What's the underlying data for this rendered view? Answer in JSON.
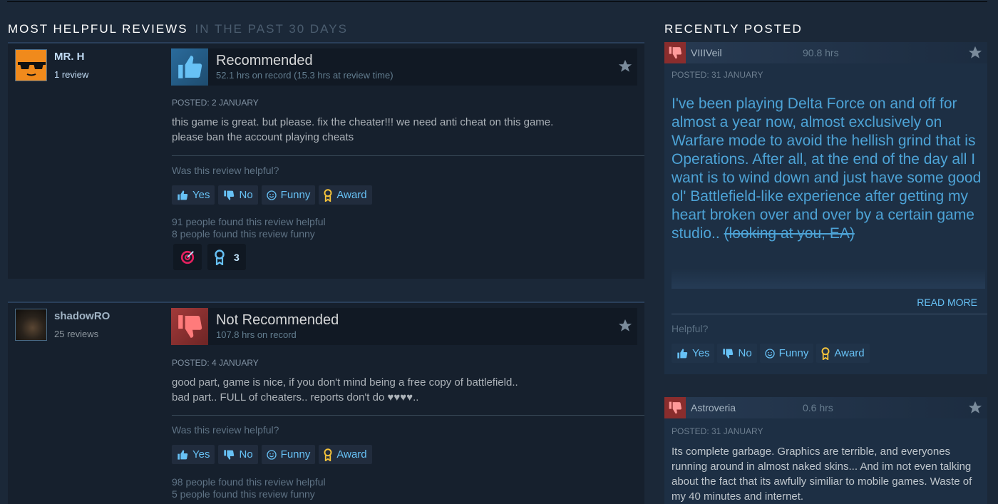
{
  "headings": {
    "most_helpful": "MOST HELPFUL REVIEWS",
    "period": "IN THE PAST 30 DAYS",
    "recently_posted": "RECENTLY POSTED"
  },
  "reviews": [
    {
      "author": "MR. H",
      "review_count": "1 review",
      "verdict": "Recommended",
      "hours": "52.1 hrs on record (15.3 hrs at review time)",
      "posted": "POSTED: 2 JANUARY",
      "lines": [
        "this game is great. but please. fix the cheater!!! we need anti cheat on this game.",
        "please ban the account playing cheats"
      ],
      "helpful_question": "Was this review helpful?",
      "buttons": {
        "yes": "Yes",
        "no": "No",
        "funny": "Funny",
        "award": "Award"
      },
      "helpful_count": "91 people found this review helpful",
      "funny_count": "8 people found this review funny",
      "award_count": "3"
    },
    {
      "author": "shadowRO",
      "review_count": "25 reviews",
      "verdict": "Not Recommended",
      "hours": "107.8 hrs on record",
      "posted": "POSTED: 4 JANUARY",
      "lines": [
        "good part, game is nice, if you don't mind being a free copy of battlefield..",
        "bad part.. FULL of cheaters.. reports don't do ♥♥♥♥.."
      ],
      "helpful_question": "Was this review helpful?",
      "buttons": {
        "yes": "Yes",
        "no": "No",
        "funny": "Funny",
        "award": "Award"
      },
      "helpful_count": "98 people found this review helpful",
      "funny_count": "5 people found this review funny"
    }
  ],
  "recent": [
    {
      "author": "VIIIVeil",
      "hours": "90.8 hrs",
      "posted": "POSTED: 31 JANUARY",
      "text": "I've been playing Delta Force on and off for almost a year now, almost exclusively on Warfare mode to avoid the hellish grind that is Operations. After all, at the end of the day all I want is to wind down and just have some good ol' Battlefield-like experience after getting my heart broken over and over by a certain game studio..",
      "strike_text": "(looking at you, EA)",
      "read_more": "READ MORE",
      "helpful_question": "Helpful?",
      "buttons": {
        "yes": "Yes",
        "no": "No",
        "funny": "Funny",
        "award": "Award"
      }
    },
    {
      "author": "Astroveria",
      "hours": "0.6 hrs",
      "posted": "POSTED: 31 JANUARY",
      "text": "Its complete garbage. Graphics are terrible, and everyones running around in almost naked skins... And im not even talking about the fact that its awfully similiar to mobile games. Waste of my 40 minutes and internet."
    }
  ],
  "colors": {
    "background": "#1b2838",
    "accent": "#67c1f5",
    "recommended": "#2a6b9c",
    "not_recommended": "#a33a3a"
  },
  "icons": [
    "thumbs-up-icon",
    "thumbs-down-icon",
    "star-icon",
    "funny-icon",
    "award-icon",
    "target-award-icon",
    "ribbon-award-icon"
  ]
}
